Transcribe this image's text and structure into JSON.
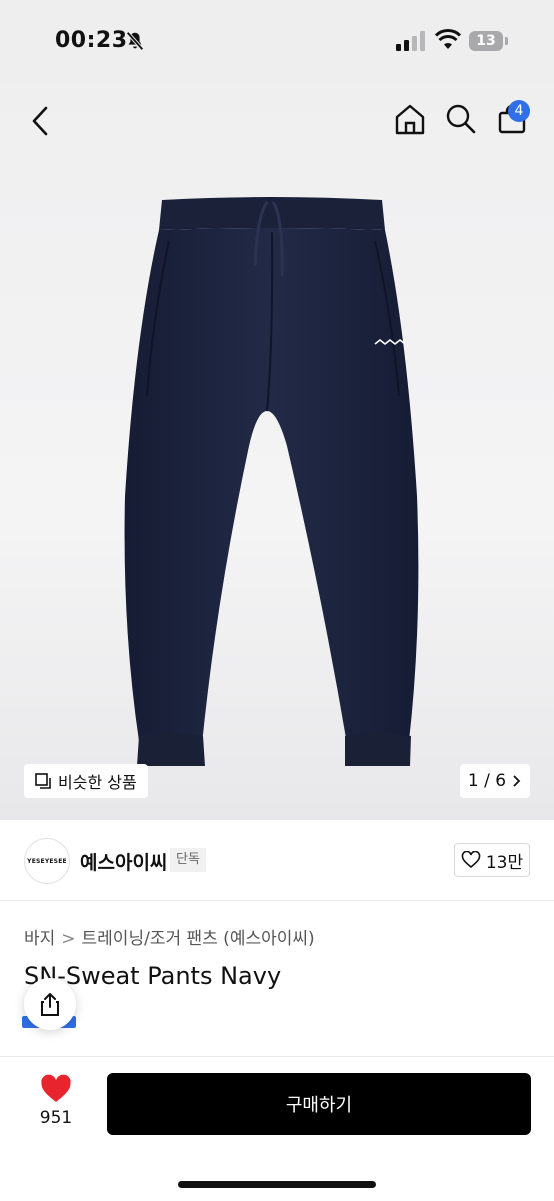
{
  "status_bar": {
    "time": "00:23",
    "battery": "13"
  },
  "nav": {
    "cart_count": "4"
  },
  "gallery": {
    "similar_label": "비슷한 상품",
    "counter": "1 / 6"
  },
  "brand": {
    "logo_text": "YESEYESEE",
    "name": "예스아이씨",
    "tag": "단독",
    "likes": "13만"
  },
  "product": {
    "breadcrumb": [
      "바지",
      "트레이닝/조거 팬츠 (예스아이씨)"
    ],
    "title": "SN-Sweat Pants Navy"
  },
  "bottom": {
    "wish_count": "951",
    "buy_label": "구매하기"
  },
  "colors": {
    "accent": "#2f6fe8",
    "wish": "#e8242c",
    "pants": "#1e2540"
  }
}
